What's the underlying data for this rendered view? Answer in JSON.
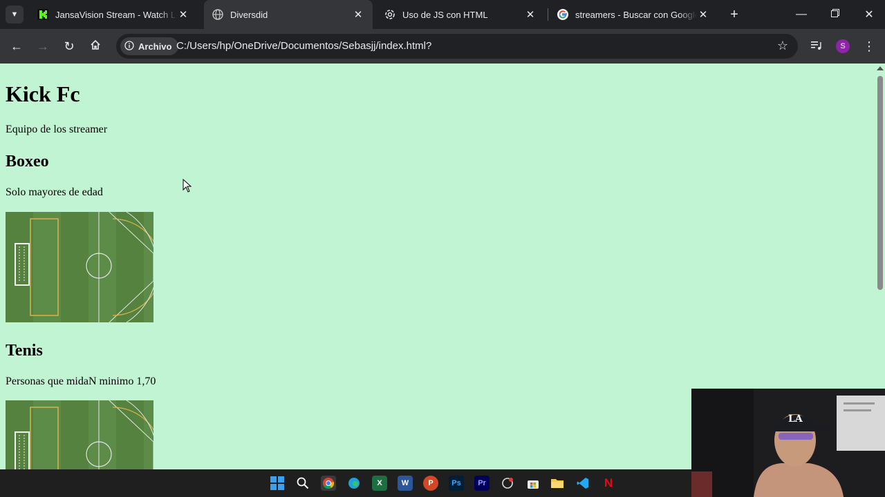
{
  "browser": {
    "tabs": [
      {
        "title": "JansaVision Stream - Watch Live on",
        "icon": "kick-icon",
        "active": false
      },
      {
        "title": "Diversdid",
        "icon": "globe-icon",
        "active": true
      },
      {
        "title": "Uso de JS con HTML",
        "icon": "chatgpt-icon",
        "active": false
      },
      {
        "title": "streamers - Buscar con Google",
        "icon": "google-icon",
        "active": false
      }
    ],
    "security_chip": "Archivo",
    "url": "C:/Users/hp/OneDrive/Documentos/Sebasjj/index.html?",
    "profile_initial": "S"
  },
  "page": {
    "heading": "Kick Fc",
    "subtitle": "Equipo de los streamer",
    "sections": [
      {
        "title": "Boxeo",
        "description": "Solo mayores de edad"
      },
      {
        "title": "Tenis",
        "description": "Personas que midaN minimo 1,70"
      }
    ]
  },
  "colors": {
    "page_background": "#c1f4d2",
    "tab_strip": "#202124",
    "toolbar": "#35363a",
    "taskbar": "#1f1f1f"
  },
  "taskbar": {
    "apps": [
      "windows-start-icon",
      "search-icon",
      "chrome-icon",
      "edge-icon",
      "excel-icon",
      "word-icon",
      "powerpoint-icon",
      "photoshop-icon",
      "premiere-icon",
      "ai-app-icon",
      "store-icon",
      "file-explorer-icon",
      "vscode-icon",
      "netflix-icon"
    ]
  }
}
